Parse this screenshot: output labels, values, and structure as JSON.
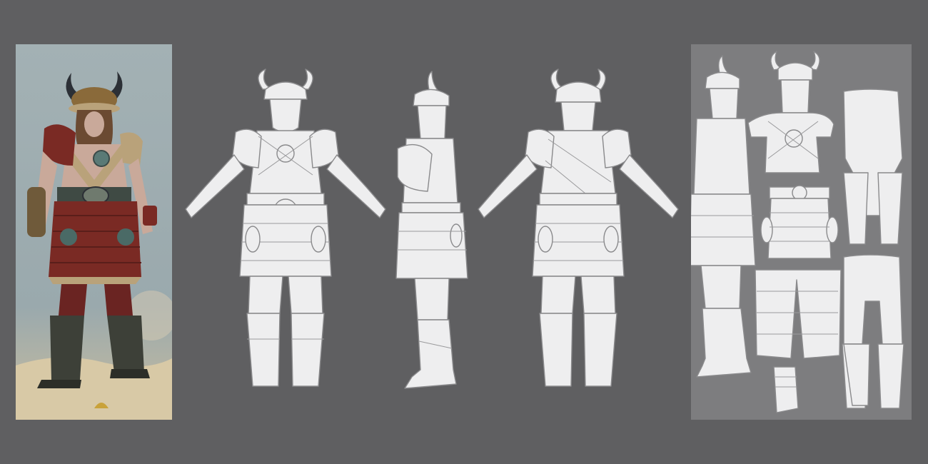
{
  "colors": {
    "background": "#5f5f61",
    "sheet_panel": "#7d7d7f",
    "lineart_fill": "#eeeeef",
    "lineart_stroke": "#8a8a8c",
    "concept_sky": "#9aa9ad",
    "concept_ground": "#d8c9a6",
    "armor_red": "#7a2a24",
    "fur": "#b9a27a",
    "metal": "#6f7a6e",
    "skin": "#c9a99a"
  },
  "views": [
    {
      "id": "front",
      "icon": "character-front-lineart"
    },
    {
      "id": "side",
      "icon": "character-side-lineart"
    },
    {
      "id": "back",
      "icon": "character-back-lineart"
    }
  ],
  "sheet_parts": [
    "armor-side-part",
    "torso-armor-part",
    "legs-part",
    "belt-skirt-part",
    "skirt-plate-part",
    "boots-part",
    "bracer-part"
  ]
}
